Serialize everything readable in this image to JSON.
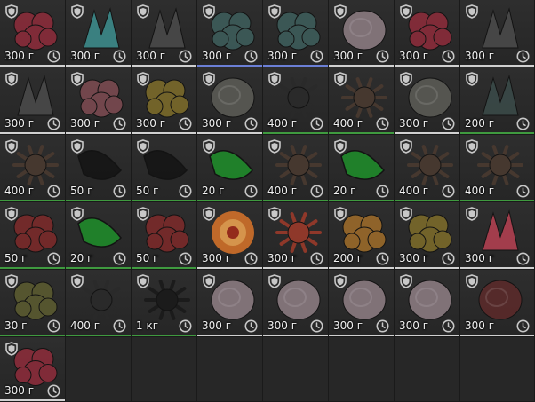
{
  "colors": {
    "cell_bg": "#2b2b2b",
    "empty_bg": "#272727",
    "text": "#f2f2f2",
    "icon": "#c8c8c8",
    "bar_white": "#d0d0d0",
    "bar_green": "#3f9a3f",
    "bar_blue": "#6b7fd6"
  },
  "rows": [
    [
      {
        "weight": "300 г",
        "item": "red-cluster-artifact",
        "color": "#8a2c3a",
        "bar": "white"
      },
      {
        "weight": "300 г",
        "item": "teal-crystal-artifact",
        "color": "#3c8a8a",
        "bar": "white"
      },
      {
        "weight": "300 г",
        "item": "dark-claw-artifact",
        "color": "#4a4a4a",
        "bar": "white"
      },
      {
        "weight": "300 г",
        "item": "teal-scrap-artifact",
        "color": "#3d5c5a",
        "bar": "blue"
      },
      {
        "weight": "300 г",
        "item": "teal-scrap-artifact",
        "color": "#3d5c5a",
        "bar": "blue"
      },
      {
        "weight": "300 г",
        "item": "rose-artifact",
        "color": "#8a7a80",
        "bar": "white"
      },
      {
        "weight": "300 г",
        "item": "red-cluster-artifact",
        "color": "#8a2c3a",
        "bar": "white"
      },
      {
        "weight": "300 г",
        "item": "dark-claw-artifact",
        "color": "#4a4a4a",
        "bar": "white"
      }
    ],
    [
      {
        "weight": "300 г",
        "item": "dark-claw-artifact",
        "color": "#4a4a4a",
        "bar": "white"
      },
      {
        "weight": "300 г",
        "item": "pink-rock-artifact",
        "color": "#7a4a50",
        "bar": "white"
      },
      {
        "weight": "300 г",
        "item": "golden-sponge-artifact",
        "color": "#7a6a2a",
        "bar": "white"
      },
      {
        "weight": "300 г",
        "item": "hollow-shell-artifact",
        "color": "#5a5a55",
        "bar": "white"
      },
      {
        "weight": "400 г",
        "item": "spiked-ball-artifact",
        "color": "#2a2a2a",
        "bar": "green"
      },
      {
        "weight": "400 г",
        "item": "brown-urchin-artifact",
        "color": "#4a3a30",
        "bar": "green"
      },
      {
        "weight": "300 г",
        "item": "hollow-shell-artifact",
        "color": "#5a5a55",
        "bar": "white"
      },
      {
        "weight": "200 г",
        "item": "dark-tentacle-artifact",
        "color": "#3a4a48",
        "bar": "green"
      }
    ],
    [
      {
        "weight": "400 г",
        "item": "brown-urchin-artifact",
        "color": "#4a3a30",
        "bar": "green"
      },
      {
        "weight": "50 г",
        "item": "black-leaf-artifact",
        "color": "#151515",
        "bar": "green"
      },
      {
        "weight": "50 г",
        "item": "black-leaf-artifact",
        "color": "#151515",
        "bar": "green"
      },
      {
        "weight": "20 г",
        "item": "green-crystal-artifact",
        "color": "#1f8a2a",
        "bar": "green"
      },
      {
        "weight": "400 г",
        "item": "brown-urchin-artifact",
        "color": "#4a3a30",
        "bar": "green"
      },
      {
        "weight": "20 г",
        "item": "green-crystal-artifact",
        "color": "#1f8a2a",
        "bar": "green"
      },
      {
        "weight": "400 г",
        "item": "brown-urchin-artifact",
        "color": "#4a3a30",
        "bar": "green"
      },
      {
        "weight": "400 г",
        "item": "brown-urchin-artifact",
        "color": "#4a3a30",
        "bar": "green"
      }
    ],
    [
      {
        "weight": "50 г",
        "item": "red-rock-artifact",
        "color": "#7a2a2a",
        "bar": "green"
      },
      {
        "weight": "20 г",
        "item": "green-crystal-artifact",
        "color": "#1f8a2a",
        "bar": "green"
      },
      {
        "weight": "50 г",
        "item": "red-rock-artifact",
        "color": "#7a2a2a",
        "bar": "green"
      },
      {
        "weight": "300 г",
        "item": "fire-swirl-artifact",
        "color": "#d0702a",
        "bar": "white"
      },
      {
        "weight": "300 г",
        "item": "red-star-artifact",
        "color": "#9a3a2a",
        "bar": "white"
      },
      {
        "weight": "200 г",
        "item": "amber-berries-artifact",
        "color": "#9a6a2a",
        "bar": "white"
      },
      {
        "weight": "300 г",
        "item": "golden-sponge-artifact",
        "color": "#7a6a2a",
        "bar": "white"
      },
      {
        "weight": "300 г",
        "item": "pink-crystal-artifact",
        "color": "#b04050",
        "bar": "white"
      }
    ],
    [
      {
        "weight": "30 г",
        "item": "mossy-disc-artifact",
        "color": "#5a5a30",
        "bar": "green"
      },
      {
        "weight": "400 г",
        "item": "spiked-ball-artifact",
        "color": "#2a2a2a",
        "bar": "green"
      },
      {
        "weight": "1 кг",
        "item": "black-spiked-artifact",
        "color": "#1a1a1a",
        "bar": "green"
      },
      {
        "weight": "300 г",
        "item": "rose-artifact",
        "color": "#8a7a80",
        "bar": "white"
      },
      {
        "weight": "300 г",
        "item": "rose-artifact",
        "color": "#8a7a80",
        "bar": "white"
      },
      {
        "weight": "300 г",
        "item": "rose-artifact",
        "color": "#8a7a80",
        "bar": "white"
      },
      {
        "weight": "300 г",
        "item": "rose-artifact",
        "color": "#8a7a80",
        "bar": "white"
      },
      {
        "weight": "300 г",
        "item": "red-egg-artifact",
        "color": "#5a2a2a",
        "bar": "white"
      }
    ],
    [
      {
        "weight": "300 г",
        "item": "red-cluster-artifact",
        "color": "#8a2c3a",
        "bar": "white"
      }
    ]
  ],
  "icons": {
    "shield": "shield-icon",
    "clock": "clock-icon"
  }
}
